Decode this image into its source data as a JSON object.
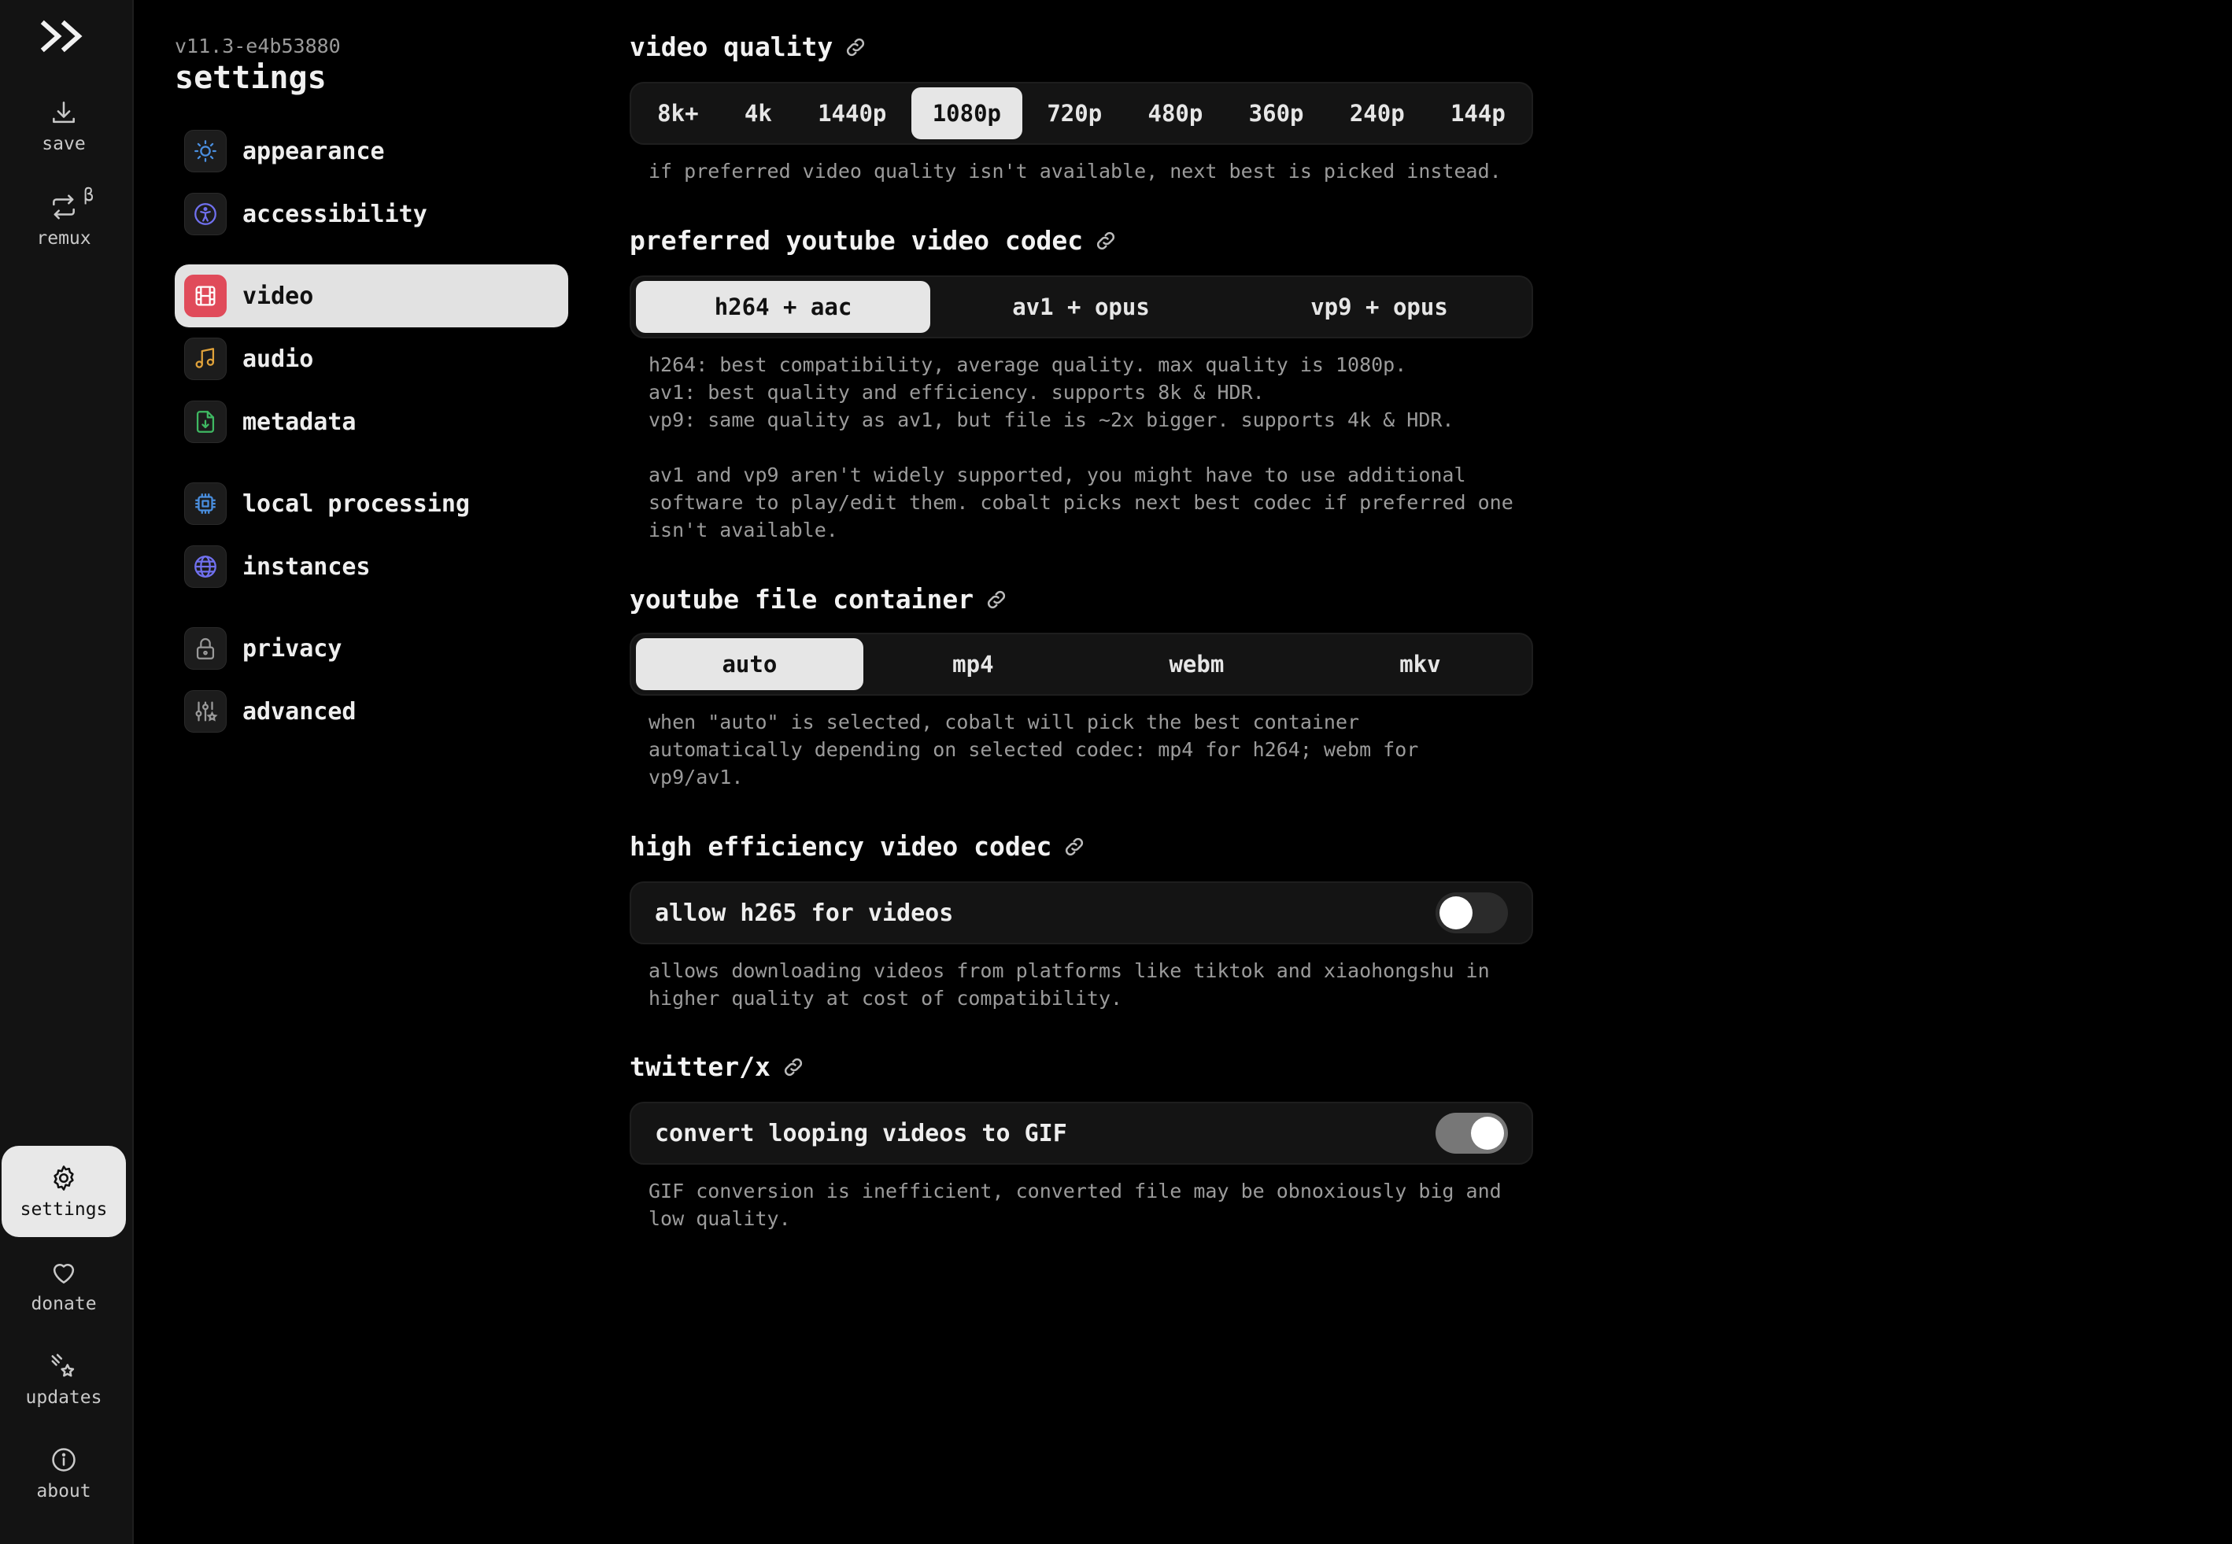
{
  "rail": {
    "top": [
      {
        "label": "save",
        "icon": "download-icon"
      },
      {
        "label": "remux",
        "icon": "remux-icon",
        "badge": "β"
      }
    ],
    "bottom": [
      {
        "label": "settings",
        "icon": "gear-icon",
        "active": true
      },
      {
        "label": "donate",
        "icon": "heart-icon"
      },
      {
        "label": "updates",
        "icon": "sparkle-icon"
      },
      {
        "label": "about",
        "icon": "info-icon"
      }
    ]
  },
  "nav": {
    "version": "v11.3-e4b53880",
    "title": "settings",
    "items": [
      {
        "label": "appearance",
        "icon": "sun-icon",
        "color": "#4a8fe0"
      },
      {
        "label": "accessibility",
        "icon": "accessibility-icon",
        "color": "#6b6be8"
      },
      {
        "label": "video",
        "icon": "film-icon",
        "color": "#e04b5a",
        "active": true
      },
      {
        "label": "audio",
        "icon": "music-icon",
        "color": "#e0a23a"
      },
      {
        "label": "metadata",
        "icon": "file-download-icon",
        "color": "#3aa85a"
      },
      {
        "label": "local processing",
        "icon": "cpu-icon",
        "color": "#4a8fe0"
      },
      {
        "label": "instances",
        "icon": "globe-icon",
        "color": "#6b6be8"
      },
      {
        "label": "privacy",
        "icon": "lock-icon",
        "color": "#9a9a9a"
      },
      {
        "label": "advanced",
        "icon": "sliders-icon",
        "color": "#9a9a9a"
      }
    ]
  },
  "sections": {
    "quality": {
      "title": "video quality",
      "options": [
        "8k+",
        "4k",
        "1440p",
        "1080p",
        "720p",
        "480p",
        "360p",
        "240p",
        "144p"
      ],
      "selected": "1080p",
      "desc": "if preferred video quality isn't available, next best is picked instead."
    },
    "codec": {
      "title": "preferred youtube video codec",
      "options": [
        "h264 + aac",
        "av1 + opus",
        "vp9 + opus"
      ],
      "selected": "h264 + aac",
      "desc": "h264: best compatibility, average quality. max quality is 1080p.\nav1: best quality and efficiency. supports 8k & HDR.\nvp9: same quality as av1, but file is ~2x bigger. supports 4k & HDR.\n\nav1 and vp9 aren't widely supported, you might have to use additional\nsoftware to play/edit them. cobalt picks next best codec if preferred one\nisn't available."
    },
    "container": {
      "title": "youtube file container",
      "options": [
        "auto",
        "mp4",
        "webm",
        "mkv"
      ],
      "selected": "auto",
      "desc": "when \"auto\" is selected, cobalt will pick the best container\nautomatically depending on selected codec: mp4 for h264; webm for\nvp9/av1."
    },
    "hevc": {
      "title": "high efficiency video codec",
      "toggle_label": "allow h265 for videos",
      "enabled": false,
      "desc": "allows downloading videos from platforms like tiktok and xiaohongshu in\nhigher quality at cost of compatibility."
    },
    "twitter": {
      "title": "twitter/x",
      "toggle_label": "convert looping videos to GIF",
      "enabled": true,
      "desc": "GIF conversion is inefficient, converted file may be obnoxiously big and\nlow quality."
    }
  }
}
